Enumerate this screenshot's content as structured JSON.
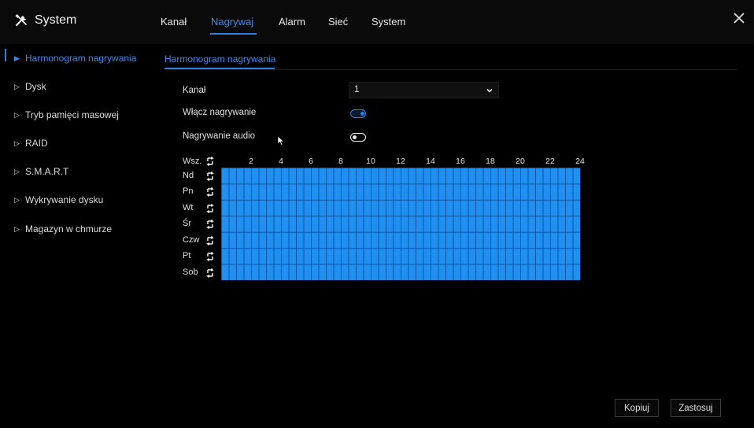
{
  "app": {
    "title": "System",
    "icon": "tools-icon",
    "close_icon": "close-icon"
  },
  "tabs": [
    {
      "label": "Kanał"
    },
    {
      "label": "Nagrywaj",
      "active": true
    },
    {
      "label": "Alarm"
    },
    {
      "label": "Sieć"
    },
    {
      "label": "System"
    }
  ],
  "sidebar": {
    "items": [
      {
        "label": "Harmonogram nagrywania",
        "active": true
      },
      {
        "label": "Dysk"
      },
      {
        "label": "Tryb pamięci masowej"
      },
      {
        "label": "RAID"
      },
      {
        "label": "S.M.A.R.T"
      },
      {
        "label": "Wykrywanie dysku"
      },
      {
        "label": "Magazyn w chmurze"
      }
    ]
  },
  "subtab": {
    "label": "Harmonogram nagrywania"
  },
  "form": {
    "channel_label": "Kanał",
    "channel_value": "1",
    "enable_recording_label": "Włącz nagrywanie",
    "enable_recording_on": true,
    "audio_recording_label": "Nagrywanie audio",
    "audio_recording_on": false
  },
  "schedule": {
    "all_label": "Wsz.",
    "days": [
      "Nd",
      "Pn",
      "Wt",
      "Śr",
      "Czw",
      "Pt",
      "Sob"
    ],
    "hour_labels": [
      "2",
      "4",
      "6",
      "8",
      "10",
      "12",
      "14",
      "16",
      "18",
      "20",
      "22",
      "24"
    ],
    "all_hours_scheduled": true,
    "schedule_color": "#1f8ff0"
  },
  "buttons": {
    "copy_label": "Kopiuj",
    "apply_label": "Zastosuj"
  },
  "colors": {
    "accent": "#2d7fe0",
    "background": "#000000"
  }
}
